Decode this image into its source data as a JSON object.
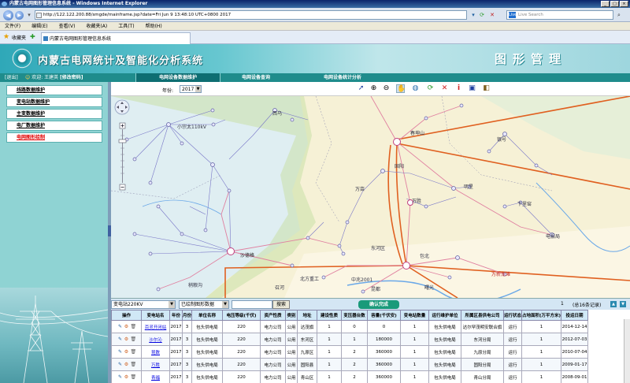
{
  "browser": {
    "window_title": "内蒙古电网图形管理信息系统 - Windows Internet Explorer",
    "url": "http://122.122.200.88/smgde/mainframe.jsp?date=Fri Jun 9 13:48:10 UTC+0800 2017",
    "search_placeholder": "Live Search",
    "search_brand": "Live",
    "menu": [
      "文件(F)",
      "编辑(E)",
      "查看(V)",
      "收藏夹(A)",
      "工具(T)",
      "帮助(H)"
    ],
    "favorites_label": "收藏夹",
    "tab_title": "内蒙古电网图形管理信息系统"
  },
  "app": {
    "title": "内蒙古电网统计及智能化分析系统",
    "module_title": "图形管理",
    "logout": "[退出]",
    "user_text": "欢迎: 王建英",
    "change_password": "[修改密码]",
    "nav_tabs": [
      {
        "label": "电网设备数据维护",
        "active": true
      },
      {
        "label": "电网设备查询",
        "active": false
      },
      {
        "label": "电网设备统计分析",
        "active": false
      }
    ]
  },
  "sidebar": {
    "items": [
      {
        "label": "线路数据维护",
        "active": false
      },
      {
        "label": "变电站数据维护",
        "active": false
      },
      {
        "label": "主变数据维护",
        "active": false
      },
      {
        "label": "电厂数据维护",
        "active": false
      },
      {
        "label": "电网图形绘制",
        "active": true
      }
    ]
  },
  "map_toolbar": {
    "year_label": "年份:",
    "year_value": "2017",
    "tools": [
      "pointer-icon",
      "zoom-in-icon",
      "zoom-out-icon",
      "pan-hand-icon",
      "globe-icon",
      "refresh-icon",
      "delete-icon",
      "info-icon",
      "save-icon",
      "layers-icon"
    ]
  },
  "map_labels": [
    "西乌",
    "小宗太110kV",
    "春坤山",
    "银号",
    "固阳",
    "明星",
    "万亩",
    "下里窑",
    "万胜",
    "电报局",
    "东河区",
    "沙德格",
    "召河",
    "包北",
    "北方重工",
    "中兆2001",
    "昆都",
    "曙光",
    "万新龙滩",
    "稍粮沟"
  ],
  "query_bar": {
    "type_value": "变电站220KV",
    "filter_value": "已绘制图形数据",
    "search_button": "搜索",
    "confirm_button": "确认完成",
    "page_number": "1",
    "record_count": "(总16条记录)"
  },
  "table": {
    "headers": [
      "操作",
      "变电站名",
      "年份",
      "月份",
      "单位名称",
      "电压等级(千伏)",
      "资产性质",
      "类别",
      "地址",
      "建设性质",
      "变压器台数",
      "容量(千伏安)",
      "变电站数量",
      "运行维护单位",
      "所属区县供电公司",
      "运行状态",
      "占地面积(万平方米)",
      "投运日期"
    ],
    "rows": [
      [
        "",
        "百灵开闭站",
        "2017",
        "3",
        "包头供电局",
        "220",
        "电力公司",
        "公用",
        "达茂旗",
        "1",
        "0",
        "0",
        "1",
        "包头供电局",
        "达尔罕茂明安联合旗",
        "运行",
        "1",
        "2014-12-14"
      ],
      [
        "",
        "沙尔沁",
        "2017",
        "3",
        "包头供电局",
        "220",
        "电力公司",
        "公用",
        "东河区",
        "1",
        "1",
        "180000",
        "1",
        "包头供电局",
        "东河分局",
        "运行",
        "1",
        "2012-07-03"
      ],
      [
        "",
        "昆数",
        "2017",
        "3",
        "包头供电局",
        "220",
        "电力公司",
        "公用",
        "九原区",
        "1",
        "2",
        "360000",
        "1",
        "包头供电局",
        "九原分局",
        "运行",
        "1",
        "2010-07-04"
      ],
      [
        "",
        "万胜",
        "2017",
        "3",
        "包头供电局",
        "220",
        "电力公司",
        "公用",
        "固阳县",
        "1",
        "2",
        "360000",
        "1",
        "包头供电局",
        "固阳分局",
        "运行",
        "1",
        "2009-01-17"
      ],
      [
        "",
        "青福",
        "2017",
        "3",
        "包头供电局",
        "220",
        "电力公司",
        "公用",
        "青山区",
        "1",
        "2",
        "360000",
        "1",
        "包头供电局",
        "青山分局",
        "运行",
        "1",
        "2008-09-01"
      ]
    ]
  }
}
